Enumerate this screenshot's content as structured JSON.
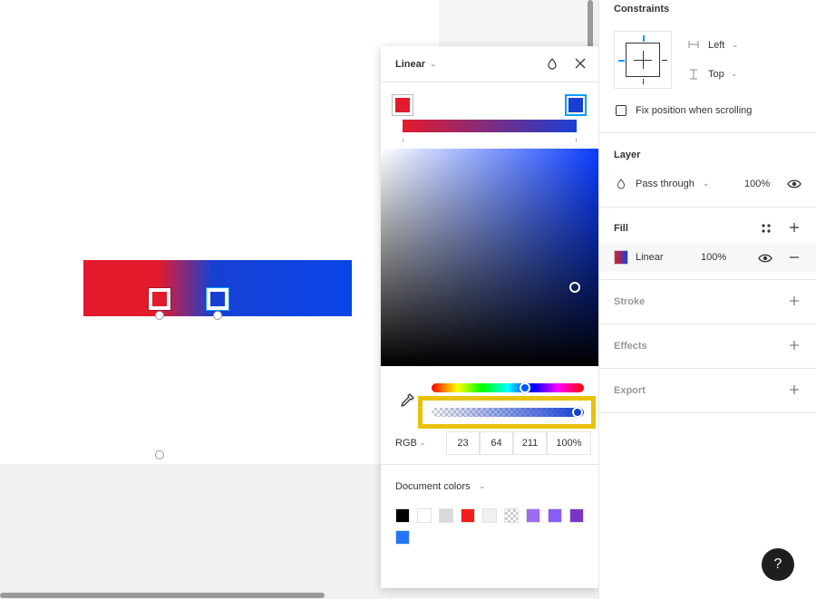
{
  "picker": {
    "mode": "Linear",
    "color_model": "RGB",
    "r": "23",
    "g": "64",
    "b": "211",
    "alpha": "100%",
    "doc_colors_label": "Document colors",
    "doc_colors": [
      "#000000",
      "#ffffff",
      "#d9d9d9",
      "#f21d1d",
      "#f0f0f0",
      "checker",
      "#9e6cf0",
      "#8a5cf6",
      "#7b35c4",
      "#2276f5"
    ],
    "highlight_color": "#e8c10c"
  },
  "panel": {
    "constraints_title": "Constraints",
    "horizontal": "Left",
    "vertical": "Top",
    "fix_position": "Fix position when scrolling",
    "layer_title": "Layer",
    "blend_mode": "Pass through",
    "layer_opacity": "100%",
    "fill_title": "Fill",
    "fill_type": "Linear",
    "fill_opacity": "100%",
    "stroke_title": "Stroke",
    "effects_title": "Effects",
    "export_title": "Export"
  },
  "help": {
    "label": "?"
  },
  "colors": {
    "stop_red": "#e31a2c",
    "stop_blue": "#1740d3",
    "accent": "#0d99ff"
  }
}
